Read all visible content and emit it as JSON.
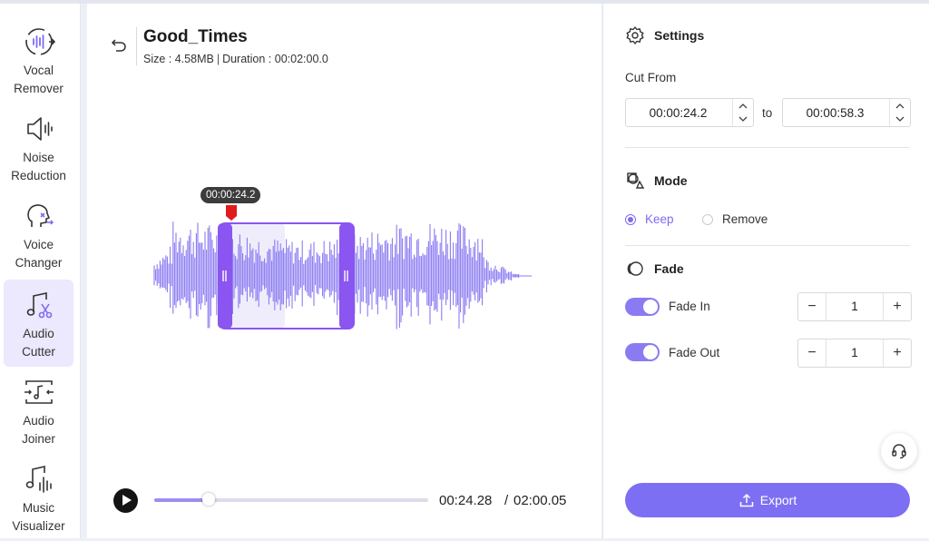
{
  "sidebar": {
    "items": [
      {
        "label": "Vocal\nRemover",
        "icon": "vocal-remover-icon",
        "active": false
      },
      {
        "label": "Noise\nReduction",
        "icon": "speaker-icon",
        "active": false
      },
      {
        "label": "Voice\nChanger",
        "icon": "voice-changer-icon",
        "active": false
      },
      {
        "label": "Audio\nCutter",
        "icon": "audio-cutter-icon",
        "active": true
      },
      {
        "label": "Audio\nJoiner",
        "icon": "audio-joiner-icon",
        "active": false
      },
      {
        "label": "Music\nVisualizer",
        "icon": "music-visualizer-icon",
        "active": false
      }
    ]
  },
  "file": {
    "title": "Good_Times",
    "size_text": "Size : 4.58MB",
    "duration_text": "Duration : 00:02:00.0"
  },
  "editor": {
    "playhead_tooltip": "00:00:24.2",
    "progress_fraction": 0.2,
    "current_time": "00:24.28",
    "total_time": "02:00.05",
    "time_separator": "/",
    "selection_start_fraction": 0.2017,
    "selection_end_fraction": 0.4858
  },
  "settings": {
    "title": "Settings",
    "cut_from_label": "Cut From",
    "start_value": "00:00:24.2",
    "to_label": "to",
    "end_value": "00:00:58.3",
    "mode_title": "Mode",
    "mode_options": [
      "Keep",
      "Remove"
    ],
    "mode_selected": "Keep",
    "fade_title": "Fade",
    "fade_in_label": "Fade In",
    "fade_in_value": "1",
    "fade_out_label": "Fade Out",
    "fade_out_value": "1",
    "minus_symbol": "−",
    "plus_symbol": "+",
    "export_label": "Export"
  },
  "colors": {
    "accent": "#7d6ff3",
    "waveform": "#8a7bf2",
    "playhead_marker": "#e01b1b",
    "selection_fill": "#efedfb"
  }
}
